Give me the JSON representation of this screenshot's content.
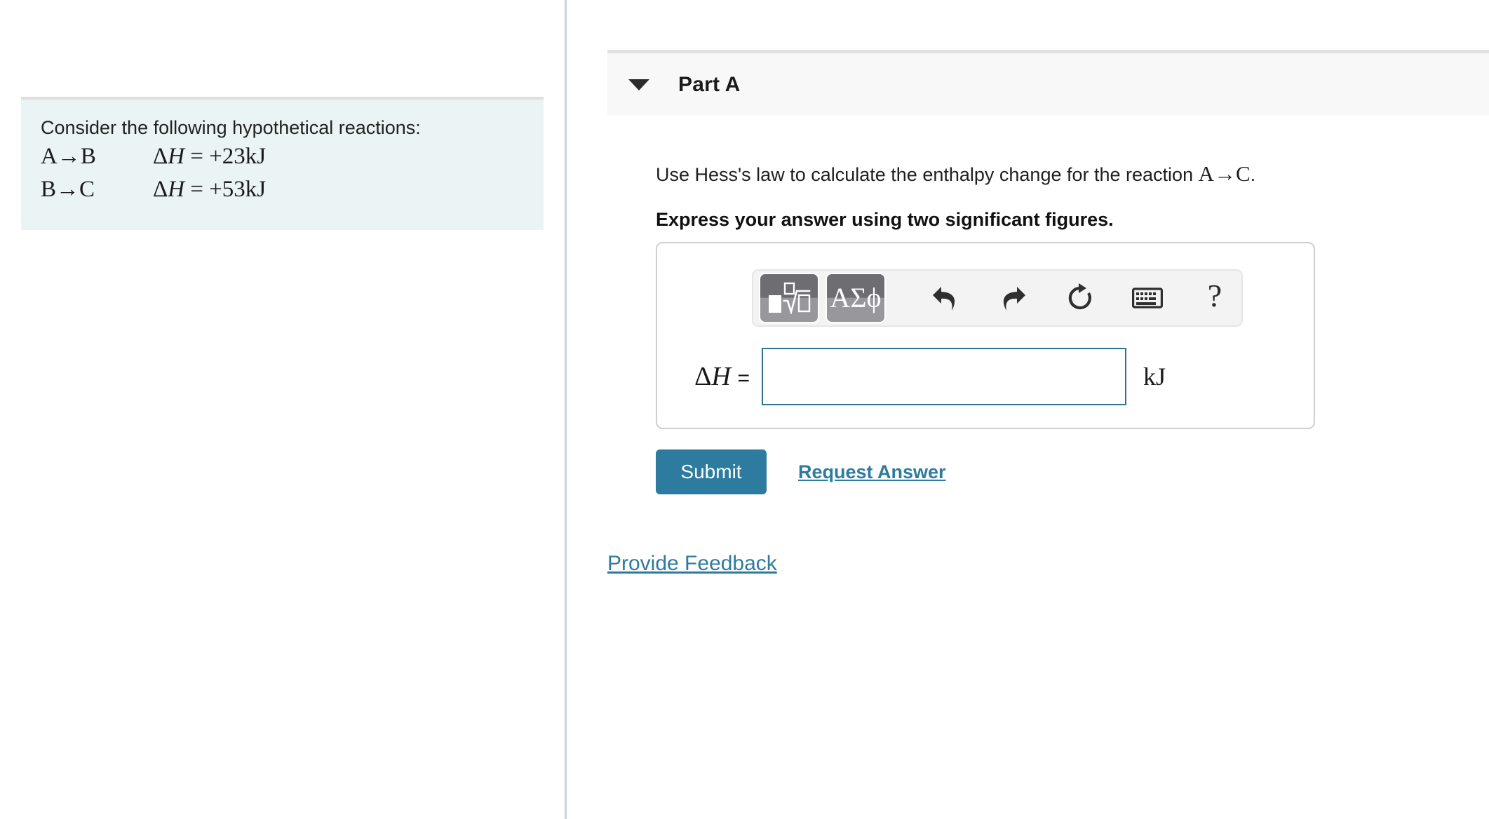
{
  "left_panel": {
    "intro_text": "Consider the following hypothetical reactions:",
    "reactions": [
      {
        "equation": "A→B",
        "delta_symbol": "Δ",
        "h_symbol": "H",
        "value": "= +23kJ"
      },
      {
        "equation": "B→C",
        "delta_symbol": "Δ",
        "h_symbol": "H",
        "value": "= +53kJ"
      }
    ]
  },
  "part": {
    "title": "Part A",
    "collapse_icon": "caret-down-icon",
    "question_text_before": "Use Hess's law to calculate the enthalpy change for the reaction ",
    "question_math": "A→C",
    "question_text_after": ".",
    "instruction": "Express your answer using two significant figures."
  },
  "answer_card": {
    "toolbar": {
      "buttons": [
        {
          "name": "math-template-button",
          "label": "template-radical-icon"
        },
        {
          "name": "greek-symbols-button",
          "label": "ΑΣϕ"
        },
        {
          "name": "undo-button",
          "label": "undo-icon"
        },
        {
          "name": "redo-button",
          "label": "redo-icon"
        },
        {
          "name": "reset-button",
          "label": "reset-icon"
        },
        {
          "name": "keyboard-button",
          "label": "keyboard-icon"
        },
        {
          "name": "help-button",
          "label": "?"
        }
      ],
      "greek_label": "ΑΣϕ",
      "help_label": "?"
    },
    "variable_delta": "Δ",
    "variable_h": "H",
    "equals": "=",
    "input_value": "",
    "input_placeholder": "",
    "unit": "kJ"
  },
  "actions": {
    "submit_label": "Submit",
    "request_answer_label": "Request Answer"
  },
  "footer": {
    "provide_feedback_label": "Provide Feedback"
  },
  "colors": {
    "accent": "#2d7b9e",
    "info_box_bg": "#eaf4f4",
    "header_bg": "#f8f8f8",
    "divider": "#c5d5e1",
    "input_border": "#2d7296"
  }
}
